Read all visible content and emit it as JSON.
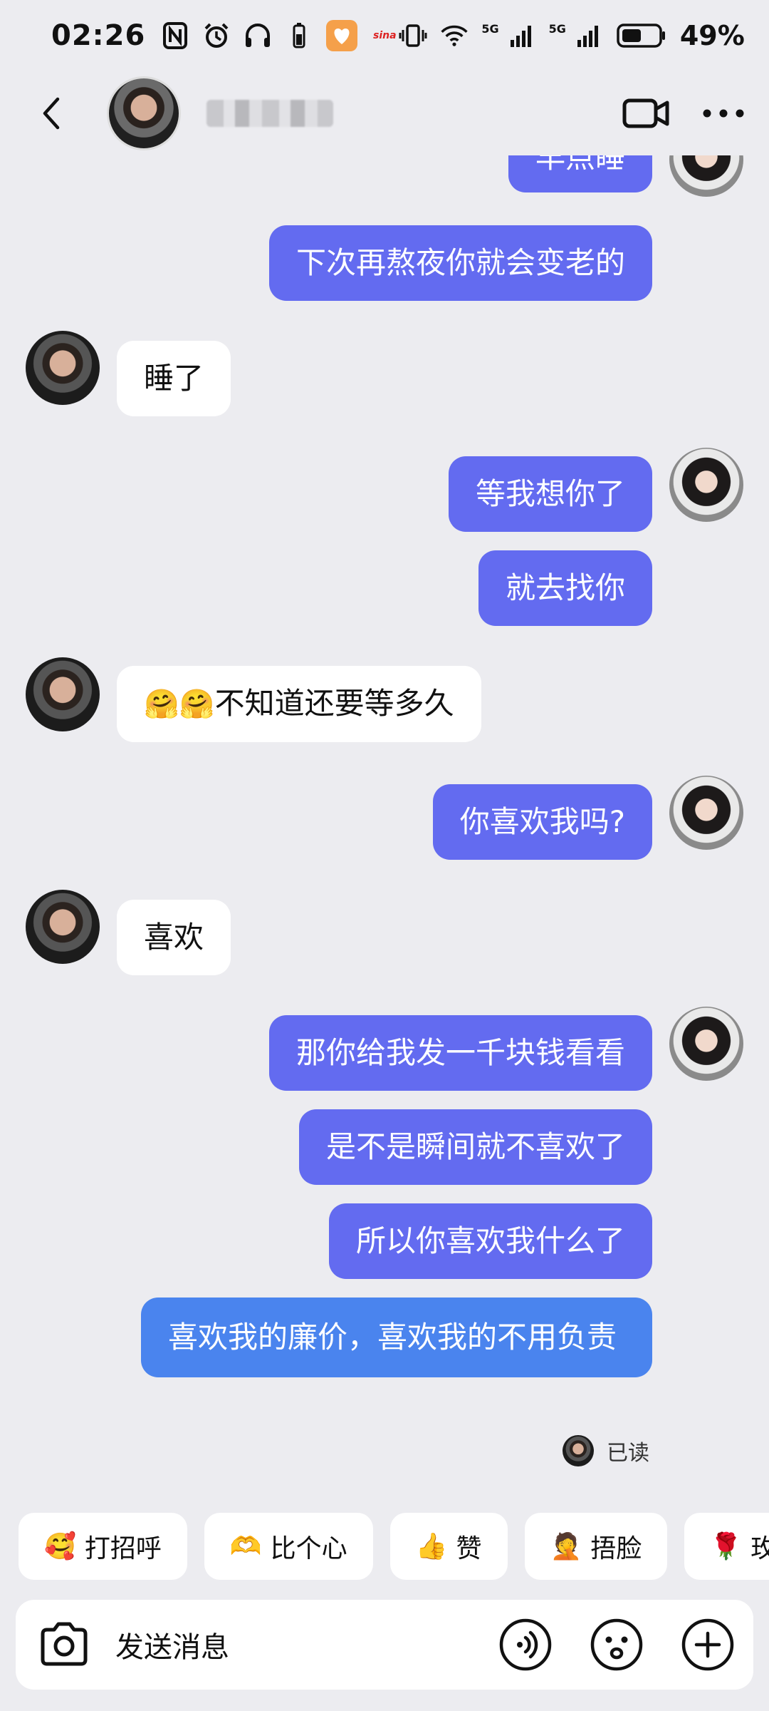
{
  "status_bar": {
    "time": "02:26",
    "network_1": "5G",
    "network_2": "5G",
    "battery": "49%",
    "app_label": "sina"
  },
  "header": {
    "contact_name_hidden": true,
    "icons": [
      "back-arrow-icon",
      "video-call-icon",
      "more-icon"
    ]
  },
  "messages": [
    {
      "side": "out",
      "text": "早点睡"
    },
    {
      "side": "out",
      "text": "下次再熬夜你就会变老的"
    },
    {
      "side": "in",
      "text": "睡了"
    },
    {
      "side": "out",
      "text": "等我想你了"
    },
    {
      "side": "out",
      "text": "就去找你"
    },
    {
      "side": "in",
      "emoji": "🤗🤗",
      "text": "不知道还要等多久"
    },
    {
      "side": "out",
      "text": "你喜欢我吗?"
    },
    {
      "side": "in",
      "text": "喜欢"
    },
    {
      "side": "out",
      "text": "那你给我发一千块钱看看"
    },
    {
      "side": "out",
      "text": "是不是瞬间就不喜欢了"
    },
    {
      "side": "out",
      "text": "所以你喜欢我什么了"
    },
    {
      "side": "out",
      "text": "喜欢我的廉价，喜欢我的不用负责"
    }
  ],
  "read_receipt": "已读",
  "quick_replies": [
    {
      "emoji": "🥰",
      "label": "打招呼"
    },
    {
      "emoji": "🫶",
      "label": "比个心"
    },
    {
      "emoji": "👍",
      "label": "赞"
    },
    {
      "emoji": "🤦",
      "label": "捂脸"
    },
    {
      "emoji": "🌹",
      "label": "玫"
    }
  ],
  "input": {
    "placeholder": "发送消息"
  },
  "colors": {
    "background": "#ececf0",
    "outgoing_bubble": "#636bf0",
    "outgoing_bubble_last": "#4a84ee",
    "incoming_bubble": "#ffffff"
  }
}
